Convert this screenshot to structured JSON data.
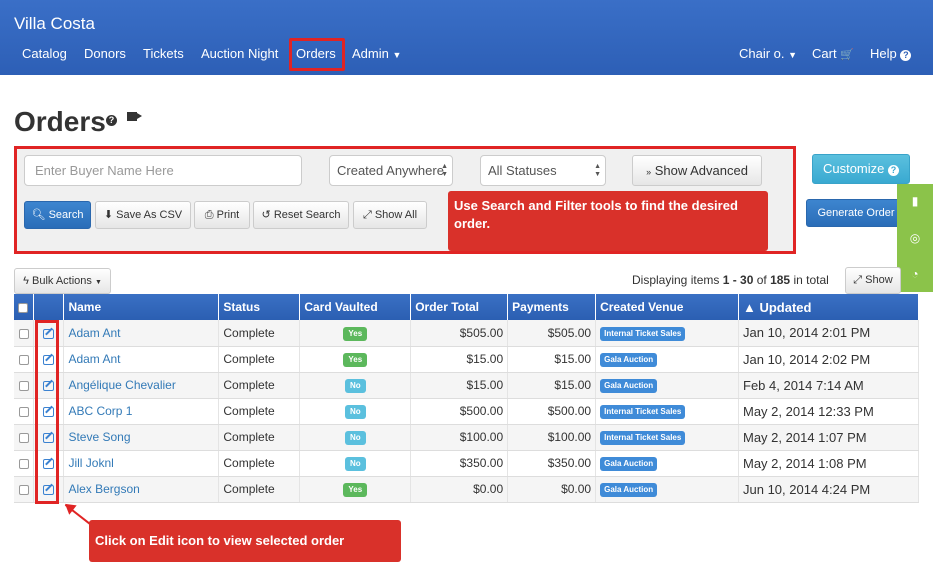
{
  "navbar": {
    "brand": "Villa Costa",
    "items": [
      "Catalog",
      "Donors",
      "Tickets",
      "Auction Night",
      "Orders",
      "Admin"
    ],
    "right": [
      "Chair o.",
      "Cart",
      "Help"
    ]
  },
  "page": {
    "title": "Orders"
  },
  "filters": {
    "buyer_placeholder": "Enter Buyer Name Here",
    "created_select": "Created Anywhere",
    "status_select": "All Statuses",
    "show_advanced": "Show Advanced",
    "customize": "Customize",
    "generate_order": "Generate Order",
    "search": "Search",
    "save_csv": "Save As CSV",
    "print": "Print",
    "reset_search": "Reset Search",
    "show_all": "Show All"
  },
  "callouts": {
    "search_tip": "Use Search and Filter tools to find the desired order.",
    "edit_tip": "Click on Edit icon to view selected order"
  },
  "list": {
    "bulk_actions": "Bulk Actions",
    "displaying_prefix": "Displaying items ",
    "range": "1 - 30",
    "of": " of ",
    "total": "185",
    "suffix": " in total",
    "show_btn": "Show"
  },
  "table": {
    "headers": [
      "Name",
      "Status",
      "Card Vaulted",
      "Order Total",
      "Payments",
      "Created Venue",
      "▲ Updated"
    ],
    "rows": [
      {
        "name": "Adam Ant",
        "status": "Complete",
        "vaulted": "Yes",
        "total": "$505.00",
        "payments": "$505.00",
        "venue": "Internal Ticket Sales",
        "updated": "Jan 10, 2014 2:01 PM"
      },
      {
        "name": "Adam Ant",
        "status": "Complete",
        "vaulted": "Yes",
        "total": "$15.00",
        "payments": "$15.00",
        "venue": "Gala Auction",
        "updated": "Jan 10, 2014 2:02 PM"
      },
      {
        "name": "Angélique Chevalier",
        "status": "Complete",
        "vaulted": "No",
        "total": "$15.00",
        "payments": "$15.00",
        "venue": "Gala Auction",
        "updated": "Feb 4, 2014 7:14 AM"
      },
      {
        "name": "ABC Corp 1",
        "status": "Complete",
        "vaulted": "No",
        "total": "$500.00",
        "payments": "$500.00",
        "venue": "Internal Ticket Sales",
        "updated": "May 2, 2014 12:33 PM"
      },
      {
        "name": "Steve Song",
        "status": "Complete",
        "vaulted": "No",
        "total": "$100.00",
        "payments": "$100.00",
        "venue": "Internal Ticket Sales",
        "updated": "May 2, 2014 1:07 PM"
      },
      {
        "name": "Jill Joknl",
        "status": "Complete",
        "vaulted": "No",
        "total": "$350.00",
        "payments": "$350.00",
        "venue": "Gala Auction",
        "updated": "May 2, 2014 1:08 PM"
      },
      {
        "name": "Alex Bergson",
        "status": "Complete",
        "vaulted": "Yes",
        "total": "$0.00",
        "payments": "$0.00",
        "venue": "Gala Auction",
        "updated": "Jun 10, 2014 4:24 PM"
      }
    ]
  }
}
